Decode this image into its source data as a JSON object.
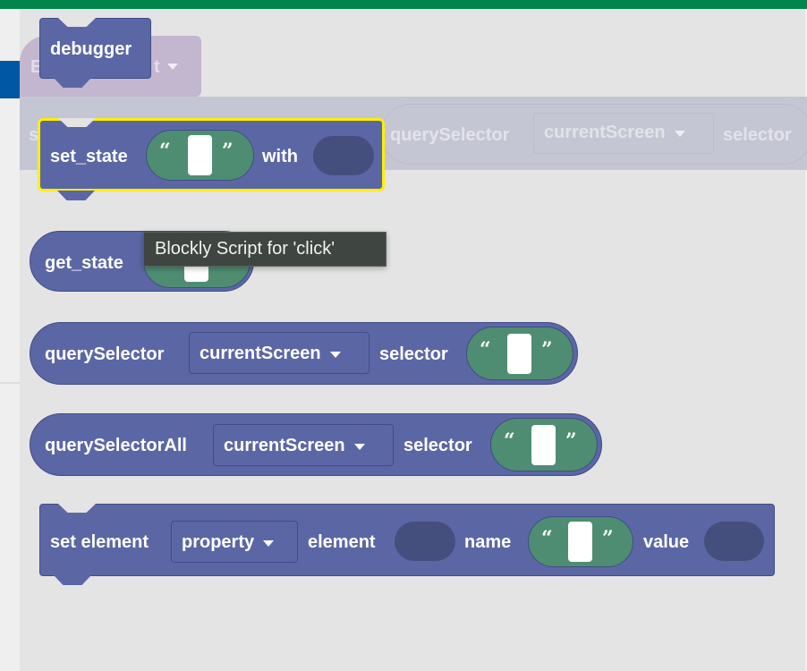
{
  "colors": {
    "block": "#5b67a5",
    "string": "#4e8d72",
    "highlight": "#ffee00",
    "tooltip": "#3f4541",
    "topbar": "#00864a"
  },
  "background_blocks": {
    "event_prefix": "E",
    "event_suffix": "t",
    "row_prefix": "s",
    "query_selector": "querySelector",
    "dropdown": "currentScreen",
    "selector": "selector"
  },
  "blocks": {
    "debugger": {
      "label": "debugger"
    },
    "set_state": {
      "label": "set_state",
      "with": "with",
      "open_quote": "“",
      "close_quote": "”"
    },
    "get_state": {
      "label": "get_state"
    },
    "query_selector": {
      "label": "querySelector",
      "dropdown": "currentScreen",
      "selector": "selector",
      "open_quote": "“",
      "close_quote": "”"
    },
    "query_selector_all": {
      "label": "querySelectorAll",
      "dropdown": "currentScreen",
      "selector": "selector",
      "open_quote": "“",
      "close_quote": "”"
    },
    "set_element": {
      "label": "set element",
      "dropdown": "property",
      "element": "element",
      "name": "name",
      "value": "value",
      "open_quote": "“",
      "close_quote": "”"
    }
  },
  "tooltip": {
    "text": "Blockly Script for 'click'"
  }
}
